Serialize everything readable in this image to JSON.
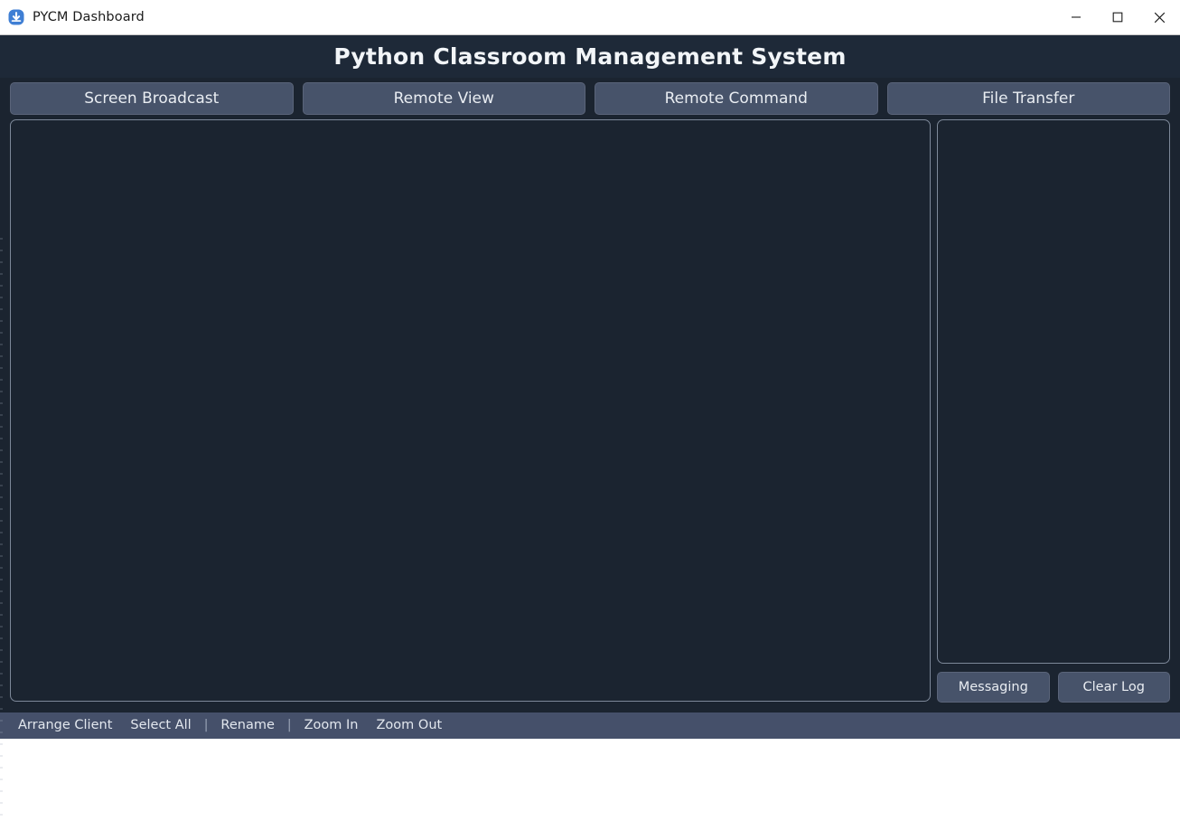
{
  "window": {
    "titlebar": {
      "icon": "download-circle-icon",
      "title": "PYCM Dashboard",
      "controls": {
        "minimize": "minimize-icon",
        "maximize": "maximize-icon",
        "close": "close-icon"
      }
    },
    "header": {
      "title": "Python Classroom Management System"
    }
  },
  "tabs": [
    {
      "id": "screen-broadcast",
      "label": "Screen Broadcast"
    },
    {
      "id": "remote-view",
      "label": "Remote View"
    },
    {
      "id": "remote-command",
      "label": "Remote Command"
    },
    {
      "id": "file-transfer",
      "label": "File Transfer"
    }
  ],
  "main": {
    "client_area": {
      "content": ""
    },
    "log_panel": {
      "content": ""
    }
  },
  "side_buttons": [
    {
      "id": "messaging",
      "label": "Messaging"
    },
    {
      "id": "clear-log",
      "label": "Clear Log"
    }
  ],
  "statusbar": {
    "items": [
      {
        "type": "link",
        "id": "arrange-client",
        "label": "Arrange Client"
      },
      {
        "type": "link",
        "id": "select-all",
        "label": "Select All"
      },
      {
        "type": "separator",
        "label": "|"
      },
      {
        "type": "link",
        "id": "rename",
        "label": "Rename"
      },
      {
        "type": "separator",
        "label": "|"
      },
      {
        "type": "link",
        "id": "zoom-in",
        "label": "Zoom In"
      },
      {
        "type": "link",
        "id": "zoom-out",
        "label": "Zoom Out"
      }
    ]
  },
  "colors": {
    "window_background": "#1b2430",
    "header_background": "#1e2938",
    "button_background": "#47536a",
    "panel_border": "#7d8899",
    "statusbar_background": "#45506a",
    "text_light": "#e9edf2",
    "titlebar_background": "#ffffff",
    "accent_icon": "#3f7fd4"
  }
}
